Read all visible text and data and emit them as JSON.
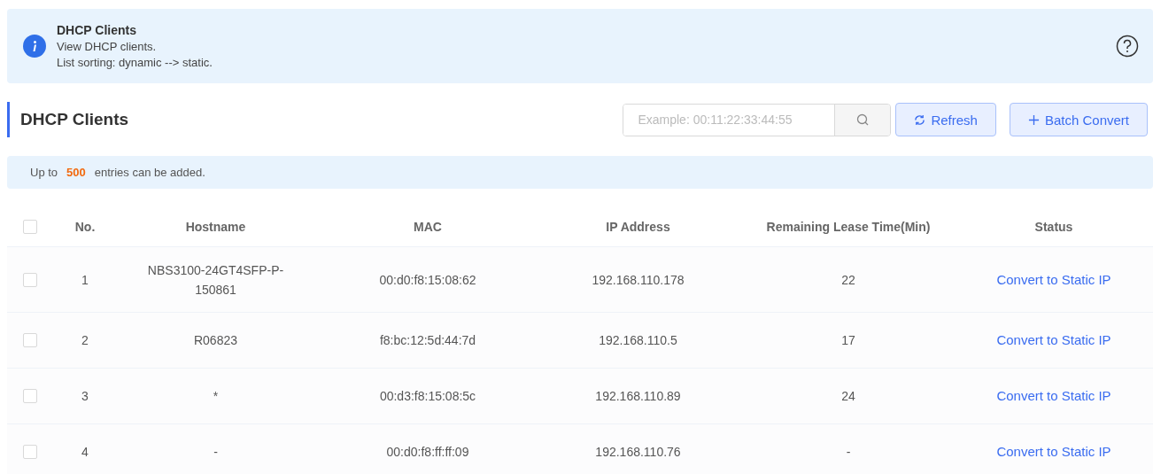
{
  "notice": {
    "title": "DHCP Clients",
    "lines": [
      "View DHCP clients.",
      "List sorting: dynamic --> static."
    ]
  },
  "section": {
    "title": "DHCP Clients"
  },
  "search": {
    "placeholder": "Example: 00:11:22:33:44:55"
  },
  "buttons": [
    {
      "kind": "refresh",
      "label": "Refresh"
    },
    {
      "kind": "add",
      "label": "Batch Convert"
    }
  ],
  "limit_note": {
    "prefix": "Up to",
    "count": "500",
    "suffix": "entries can be added."
  },
  "table": {
    "all_checked": false,
    "columns": [
      "No.",
      "Hostname",
      "MAC",
      "IP Address",
      "Remaining Lease Time(Min)",
      "Status"
    ],
    "rows": [
      {
        "checked": false,
        "no": "1",
        "hostname": "NBS3100-24GT4SFP-P-150861",
        "mac": "00:d0:f8:15:08:62",
        "ip": "192.168.110.178",
        "lease": "22",
        "action": "Convert to Static IP"
      },
      {
        "checked": false,
        "no": "2",
        "hostname": "R06823",
        "mac": "f8:bc:12:5d:44:7d",
        "ip": "192.168.110.5",
        "lease": "17",
        "action": "Convert to Static IP"
      },
      {
        "checked": false,
        "no": "3",
        "hostname": "*",
        "mac": "00:d3:f8:15:08:5c",
        "ip": "192.168.110.89",
        "lease": "24",
        "action": "Convert to Static IP"
      },
      {
        "checked": false,
        "no": "4",
        "hostname": "-",
        "mac": "00:d0:f8:ff:ff:09",
        "ip": "192.168.110.76",
        "lease": "-",
        "action": "Convert to Static IP"
      }
    ]
  }
}
